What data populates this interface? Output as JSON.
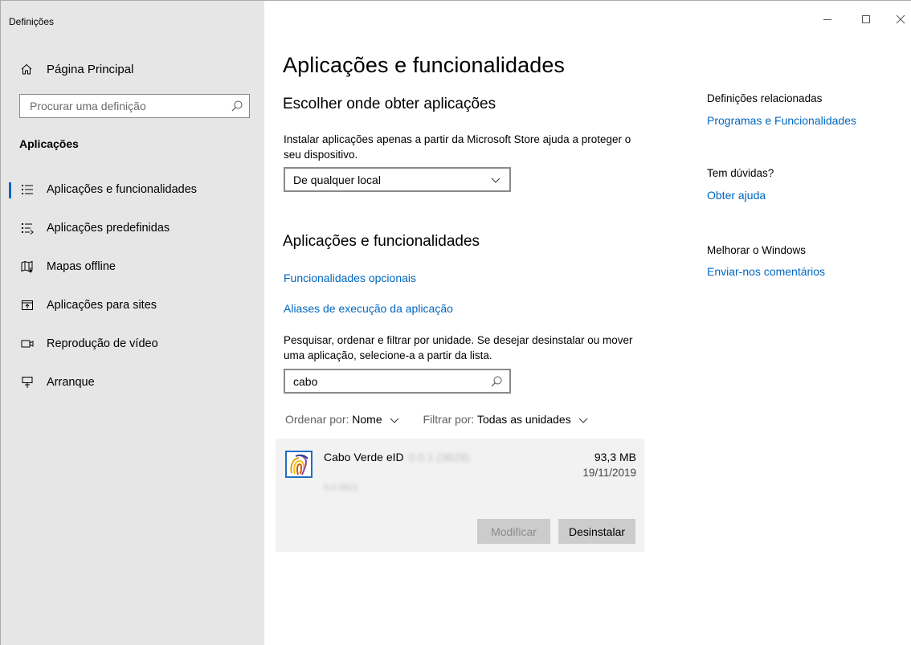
{
  "window": {
    "title": "Definições",
    "controls": {
      "minimize": "minimize-icon",
      "maximize": "maximize-icon",
      "close": "close-icon"
    }
  },
  "sidebar": {
    "home_label": "Página Principal",
    "search_placeholder": "Procurar uma definição",
    "section": "Aplicações",
    "items": [
      {
        "label": "Aplicações e funcionalidades",
        "icon": "apps-list-icon",
        "active": true
      },
      {
        "label": "Aplicações predefinidas",
        "icon": "default-apps-icon",
        "active": false
      },
      {
        "label": "Mapas offline",
        "icon": "offline-maps-icon",
        "active": false
      },
      {
        "label": "Aplicações para sites",
        "icon": "apps-for-websites-icon",
        "active": false
      },
      {
        "label": "Reprodução de vídeo",
        "icon": "video-playback-icon",
        "active": false
      },
      {
        "label": "Arranque",
        "icon": "startup-icon",
        "active": false
      }
    ]
  },
  "main": {
    "title": "Aplicações e funcionalidades",
    "choose_heading": "Escolher onde obter aplicações",
    "choose_desc": "Instalar aplicações apenas a partir da Microsoft Store ajuda a proteger o seu dispositivo.",
    "source_value": "De qualquer local",
    "apps_heading": "Aplicações e funcionalidades",
    "optional_link": "Funcionalidades opcionais",
    "aliases_link": "Aliases de execução da aplicação",
    "filter_desc": "Pesquisar, ordenar e filtrar por unidade. Se desejar desinstalar ou mover uma aplicação, selecione-a a partir da lista.",
    "filter_value": "cabo",
    "sort_label": "Ordenar por:",
    "sort_value": "Nome",
    "filter_label": "Filtrar por:",
    "filter_drive_value": "Todas as unidades",
    "app": {
      "name": "Cabo Verde eID",
      "version_blurred": "0.0.1 (3629)",
      "sub_blurred": "0.0.3621",
      "size": "93,3 MB",
      "date": "19/11/2019",
      "modify_label": "Modificar",
      "uninstall_label": "Desinstalar"
    }
  },
  "related": {
    "title": "Definições relacionadas",
    "programs_link": "Programas e Funcionalidades",
    "questions": "Tem dúvidas?",
    "help_link": "Obter ajuda",
    "improve": "Melhorar o Windows",
    "feedback_link": "Enviar-nos comentários"
  },
  "colors": {
    "accent": "#0067c0",
    "sidebar_bg": "#e6e6e6",
    "card_bg": "#f2f2f2"
  }
}
